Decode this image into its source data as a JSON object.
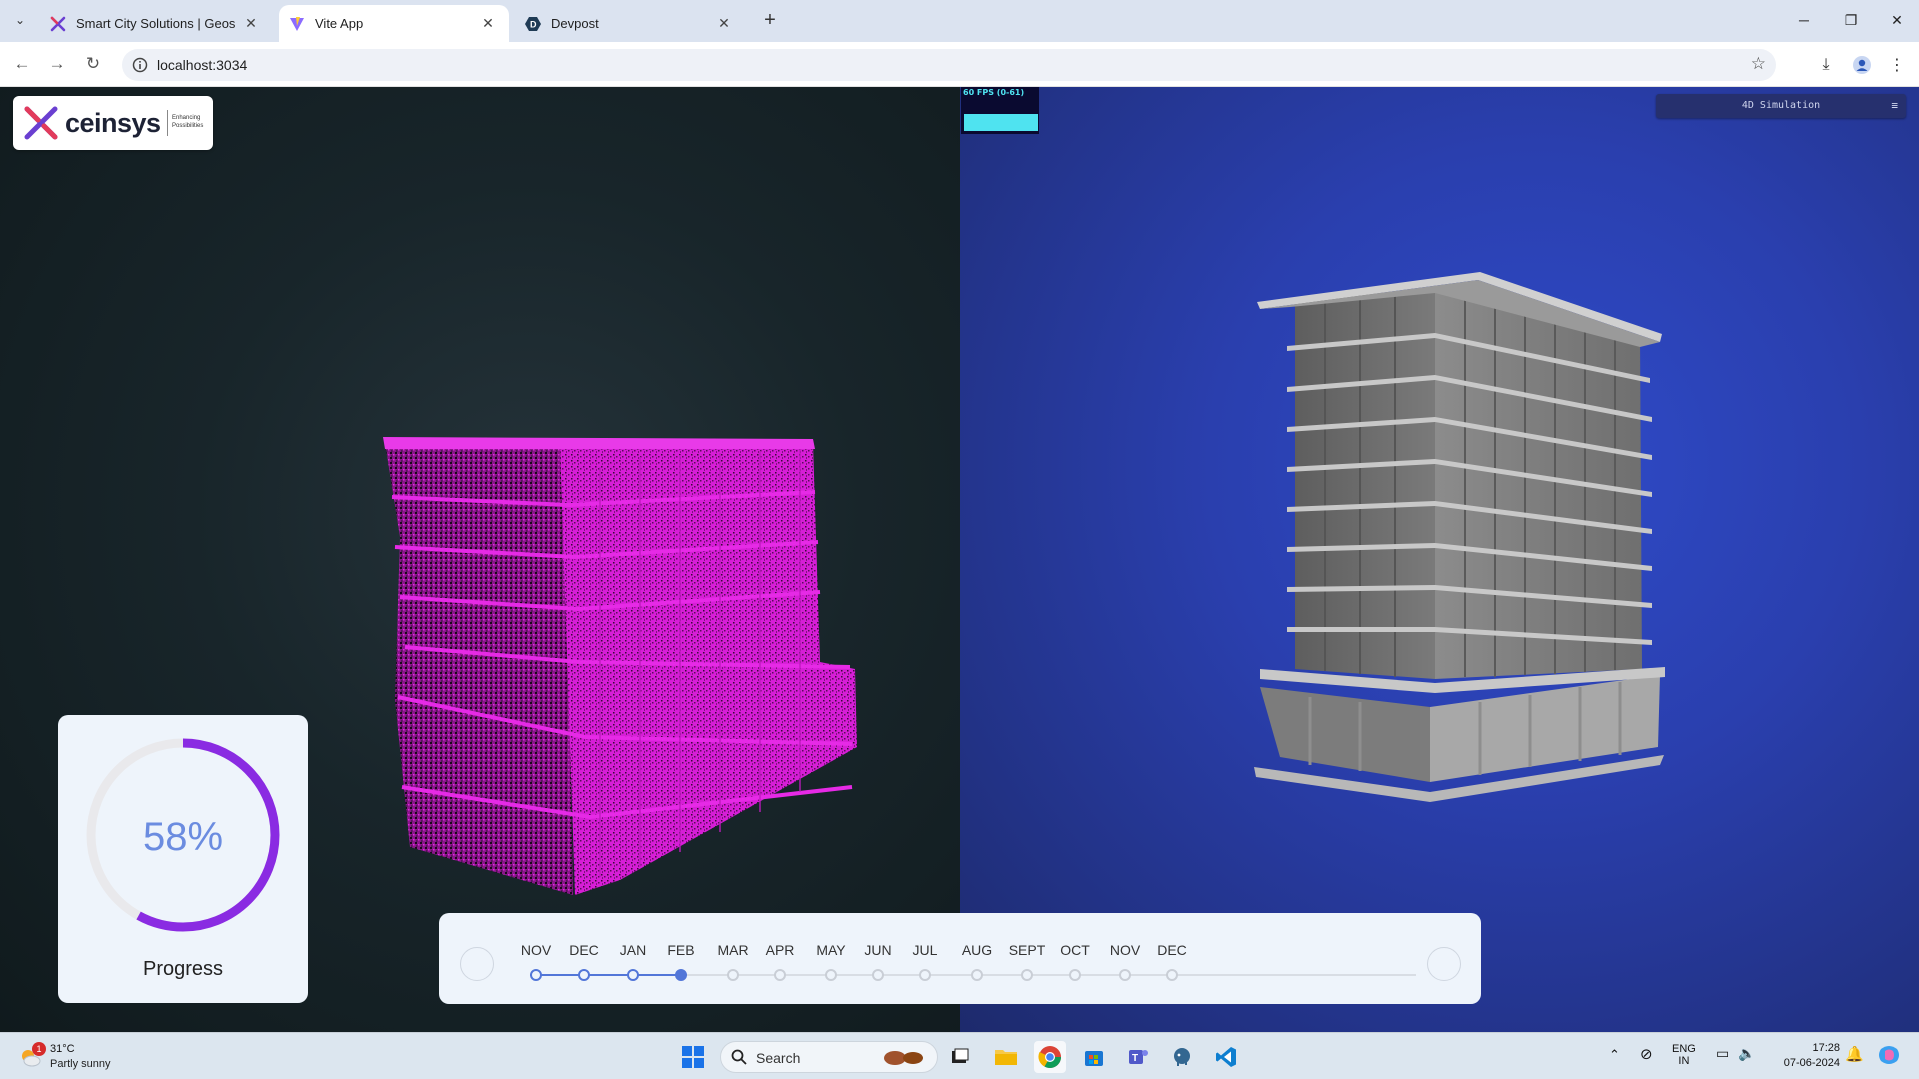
{
  "browser": {
    "tabs": [
      {
        "title": "Smart City Solutions | Geospatial",
        "active": false
      },
      {
        "title": "Vite App",
        "active": true
      },
      {
        "title": "Devpost",
        "active": false
      }
    ],
    "url": "localhost:3034"
  },
  "app": {
    "logo": {
      "word": "ceinsys",
      "tagline_1": "Enhancing",
      "tagline_2": "Possibilities"
    },
    "fps_label": "60 FPS (0-61)",
    "simulation_select": "4D Simulation",
    "progress": {
      "percent_text": "58%",
      "value": 0.58,
      "label": "Progress"
    },
    "timeline": {
      "months": [
        "NOV",
        "DEC",
        "JAN",
        "FEB",
        "MAR",
        "APR",
        "MAY",
        "JUN",
        "JUL",
        "AUG",
        "SEPT",
        "OCT",
        "NOV",
        "DEC"
      ],
      "current_index": 3
    },
    "colors": {
      "accent": "#5276d8",
      "progress_ring": "#8a2be2",
      "point_cloud": "#e020e0",
      "fps": "#4fe3f0"
    }
  },
  "taskbar": {
    "weather": {
      "temp": "31°C",
      "condition": "Partly sunny",
      "badge": "1"
    },
    "search_label": "Search",
    "lang_1": "ENG",
    "lang_2": "IN",
    "time": "17:28",
    "date": "07-06-2024"
  }
}
